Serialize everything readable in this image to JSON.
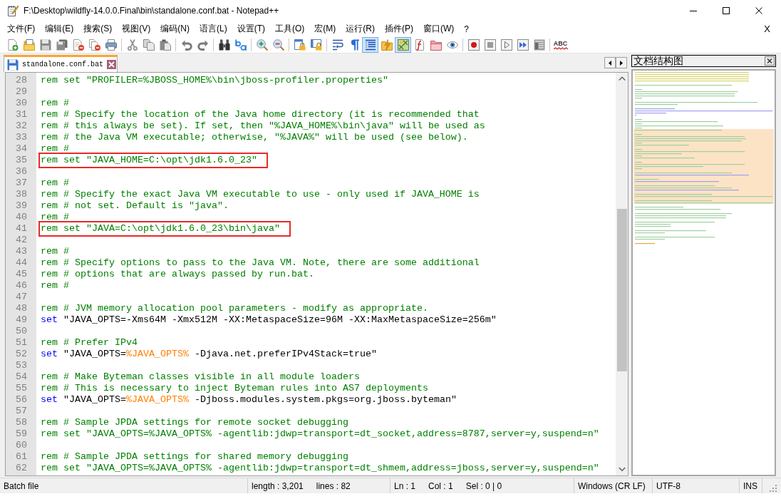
{
  "window": {
    "title": "F:\\Desktop\\wildfly-14.0.0.Final\\bin\\standalone.conf.bat - Notepad++"
  },
  "menu": {
    "items": [
      {
        "label": "文件(F)"
      },
      {
        "label": "编辑(E)"
      },
      {
        "label": "搜索(S)"
      },
      {
        "label": "视图(V)"
      },
      {
        "label": "编码(N)"
      },
      {
        "label": "语言(L)"
      },
      {
        "label": "设置(T)"
      },
      {
        "label": "工具(O)"
      },
      {
        "label": "宏(M)"
      },
      {
        "label": "运行(R)"
      },
      {
        "label": "插件(P)"
      },
      {
        "label": "窗口(W)"
      },
      {
        "label": "?"
      }
    ],
    "close_label": "X"
  },
  "toolbar": [
    [
      {
        "pressed": false
      },
      {
        "pressed": false
      },
      {
        "pressed": false
      },
      {
        "pressed": false
      },
      {
        "pressed": false
      },
      {
        "pressed": false
      },
      {
        "pressed": false
      }
    ],
    [
      {
        "pressed": false
      },
      {
        "pressed": false
      },
      {
        "pressed": false
      }
    ],
    [
      {
        "pressed": false
      },
      {
        "pressed": false
      }
    ],
    [
      {
        "pressed": false
      },
      {
        "pressed": false
      }
    ],
    [
      {
        "pressed": false
      },
      {
        "pressed": false
      }
    ],
    [
      {
        "pressed": false
      },
      {
        "pressed": false
      }
    ],
    [
      {
        "pressed": false
      },
      {
        "pressed": false
      },
      {
        "pressed": true
      },
      {
        "pressed": false
      },
      {
        "pressed": true
      },
      {
        "pressed": false
      },
      {
        "pressed": false
      },
      {
        "pressed": false
      }
    ],
    [
      {
        "pressed": false
      },
      {
        "pressed": false
      },
      {
        "pressed": false
      },
      {
        "pressed": false
      },
      {
        "pressed": false
      }
    ]
  ],
  "toolbar_end_button": {
    "label": "ABC"
  },
  "tabs": [
    {
      "label": "standalone.conf.bat",
      "selected": true
    }
  ],
  "editor": {
    "lines": [
      {
        "number": "28",
        "boxed": false,
        "segments": [
          {
            "kind": "comment",
            "text": "rem set \"PROFILER=%JBOSS_HOME%\\bin\\jboss-profiler.properties\""
          }
        ]
      },
      {
        "number": "29",
        "boxed": false
      },
      {
        "number": "30",
        "boxed": false,
        "segments": [
          {
            "kind": "comment",
            "text": "rem #"
          }
        ]
      },
      {
        "number": "31",
        "boxed": false,
        "segments": [
          {
            "kind": "comment",
            "text": "rem # Specify the location of the Java home directory (it is recommended that"
          }
        ]
      },
      {
        "number": "32",
        "boxed": false,
        "segments": [
          {
            "kind": "comment",
            "text": "rem # this always be set). If set, then \"%JAVA_HOME%\\bin\\java\" will be used as"
          }
        ]
      },
      {
        "number": "33",
        "boxed": false,
        "segments": [
          {
            "kind": "comment",
            "text": "rem # the Java VM executable; otherwise, \"%JAVA%\" will be used (see below)."
          }
        ]
      },
      {
        "number": "34",
        "boxed": false,
        "segments": [
          {
            "kind": "comment",
            "text": "rem #"
          }
        ]
      },
      {
        "number": "35",
        "boxed": true,
        "segments": [
          {
            "kind": "comment",
            "text": "rem set \"JAVA_HOME=C:\\opt\\jdk1.6.0_23\""
          }
        ]
      },
      {
        "number": "36",
        "boxed": false
      },
      {
        "number": "37",
        "boxed": false,
        "segments": [
          {
            "kind": "comment",
            "text": "rem #"
          }
        ]
      },
      {
        "number": "38",
        "boxed": false,
        "segments": [
          {
            "kind": "comment",
            "text": "rem # Specify the exact Java VM executable to use - only used if JAVA_HOME is"
          }
        ]
      },
      {
        "number": "39",
        "boxed": false,
        "segments": [
          {
            "kind": "comment",
            "text": "rem # not set. Default is \"java\"."
          }
        ]
      },
      {
        "number": "40",
        "boxed": false,
        "segments": [
          {
            "kind": "comment",
            "text": "rem #"
          }
        ]
      },
      {
        "number": "41",
        "boxed": true,
        "segments": [
          {
            "kind": "comment",
            "text": "rem set \"JAVA=C:\\opt\\jdk1.6.0_23\\bin\\java\""
          }
        ]
      },
      {
        "number": "42",
        "boxed": false
      },
      {
        "number": "43",
        "boxed": false,
        "segments": [
          {
            "kind": "comment",
            "text": "rem #"
          }
        ]
      },
      {
        "number": "44",
        "boxed": false,
        "segments": [
          {
            "kind": "comment",
            "text": "rem # Specify options to pass to the Java VM. Note, there are some additional"
          }
        ]
      },
      {
        "number": "45",
        "boxed": false,
        "segments": [
          {
            "kind": "comment",
            "text": "rem # options that are always passed by run.bat."
          }
        ]
      },
      {
        "number": "46",
        "boxed": false,
        "segments": [
          {
            "kind": "comment",
            "text": "rem #"
          }
        ]
      },
      {
        "number": "47",
        "boxed": false
      },
      {
        "number": "48",
        "boxed": false,
        "segments": [
          {
            "kind": "comment",
            "text": "rem # JVM memory allocation pool parameters - modify as appropriate."
          }
        ]
      },
      {
        "number": "49",
        "boxed": false,
        "segments": [
          {
            "kind": "keyword",
            "text": "set"
          },
          {
            "kind": "text",
            "text": " \"JAVA_OPTS=-Xms64M -Xmx512M -XX:MetaspaceSize=96M -XX:MaxMetaspaceSize=256m\""
          }
        ]
      },
      {
        "number": "50",
        "boxed": false
      },
      {
        "number": "51",
        "boxed": false,
        "segments": [
          {
            "kind": "comment",
            "text": "rem # Prefer IPv4"
          }
        ]
      },
      {
        "number": "52",
        "boxed": false,
        "segments": [
          {
            "kind": "keyword",
            "text": "set"
          },
          {
            "kind": "text",
            "text": " \"JAVA_OPTS="
          },
          {
            "kind": "variable",
            "text": "%JAVA_OPTS%"
          },
          {
            "kind": "text",
            "text": " -Djava.net.preferIPv4Stack=true\""
          }
        ]
      },
      {
        "number": "53",
        "boxed": false
      },
      {
        "number": "54",
        "boxed": false,
        "segments": [
          {
            "kind": "comment",
            "text": "rem # Make Byteman classes visible in all module loaders"
          }
        ]
      },
      {
        "number": "55",
        "boxed": false,
        "segments": [
          {
            "kind": "comment",
            "text": "rem # This is necessary to inject Byteman rules into AS7 deployments"
          }
        ]
      },
      {
        "number": "56",
        "boxed": false,
        "segments": [
          {
            "kind": "keyword",
            "text": "set"
          },
          {
            "kind": "text",
            "text": " \"JAVA_OPTS="
          },
          {
            "kind": "variable",
            "text": "%JAVA_OPTS%"
          },
          {
            "kind": "text",
            "text": " -Djboss.modules.system.pkgs=org.jboss.byteman\""
          }
        ]
      },
      {
        "number": "57",
        "boxed": false
      },
      {
        "number": "58",
        "boxed": false,
        "segments": [
          {
            "kind": "comment",
            "text": "rem # Sample JPDA settings for remote socket debugging"
          }
        ]
      },
      {
        "number": "59",
        "boxed": false,
        "segments": [
          {
            "kind": "comment",
            "text": "rem set \"JAVA_OPTS=%JAVA_OPTS% -agentlib:jdwp=transport=dt_socket,address=8787,server=y,suspend=n\""
          }
        ]
      },
      {
        "number": "60",
        "boxed": false
      },
      {
        "number": "61",
        "boxed": false,
        "segments": [
          {
            "kind": "comment",
            "text": "rem # Sample JPDA settings for shared memory debugging"
          }
        ]
      },
      {
        "number": "62",
        "boxed": false,
        "segments": [
          {
            "kind": "comment",
            "text": "rem set \"JAVA_OPTS=%JAVA_OPTS% -agentlib:jdwp=transport=dt_shmem,address=jboss,server=y,suspend=n\""
          }
        ]
      }
    ]
  },
  "document_map": {
    "title": "文档结构图"
  },
  "status_bar": [
    {
      "texts": [
        "Batch file"
      ]
    },
    {
      "texts": [
        "length : 3,201",
        "lines : 82"
      ]
    },
    {
      "texts": [
        "Ln : 1",
        "Col : 1",
        "Sel : 0 | 0"
      ]
    },
    {
      "texts": [
        "Windows (CR LF)"
      ]
    },
    {
      "texts": [
        "UTF-8"
      ]
    },
    {
      "texts": [
        "INS"
      ]
    }
  ]
}
